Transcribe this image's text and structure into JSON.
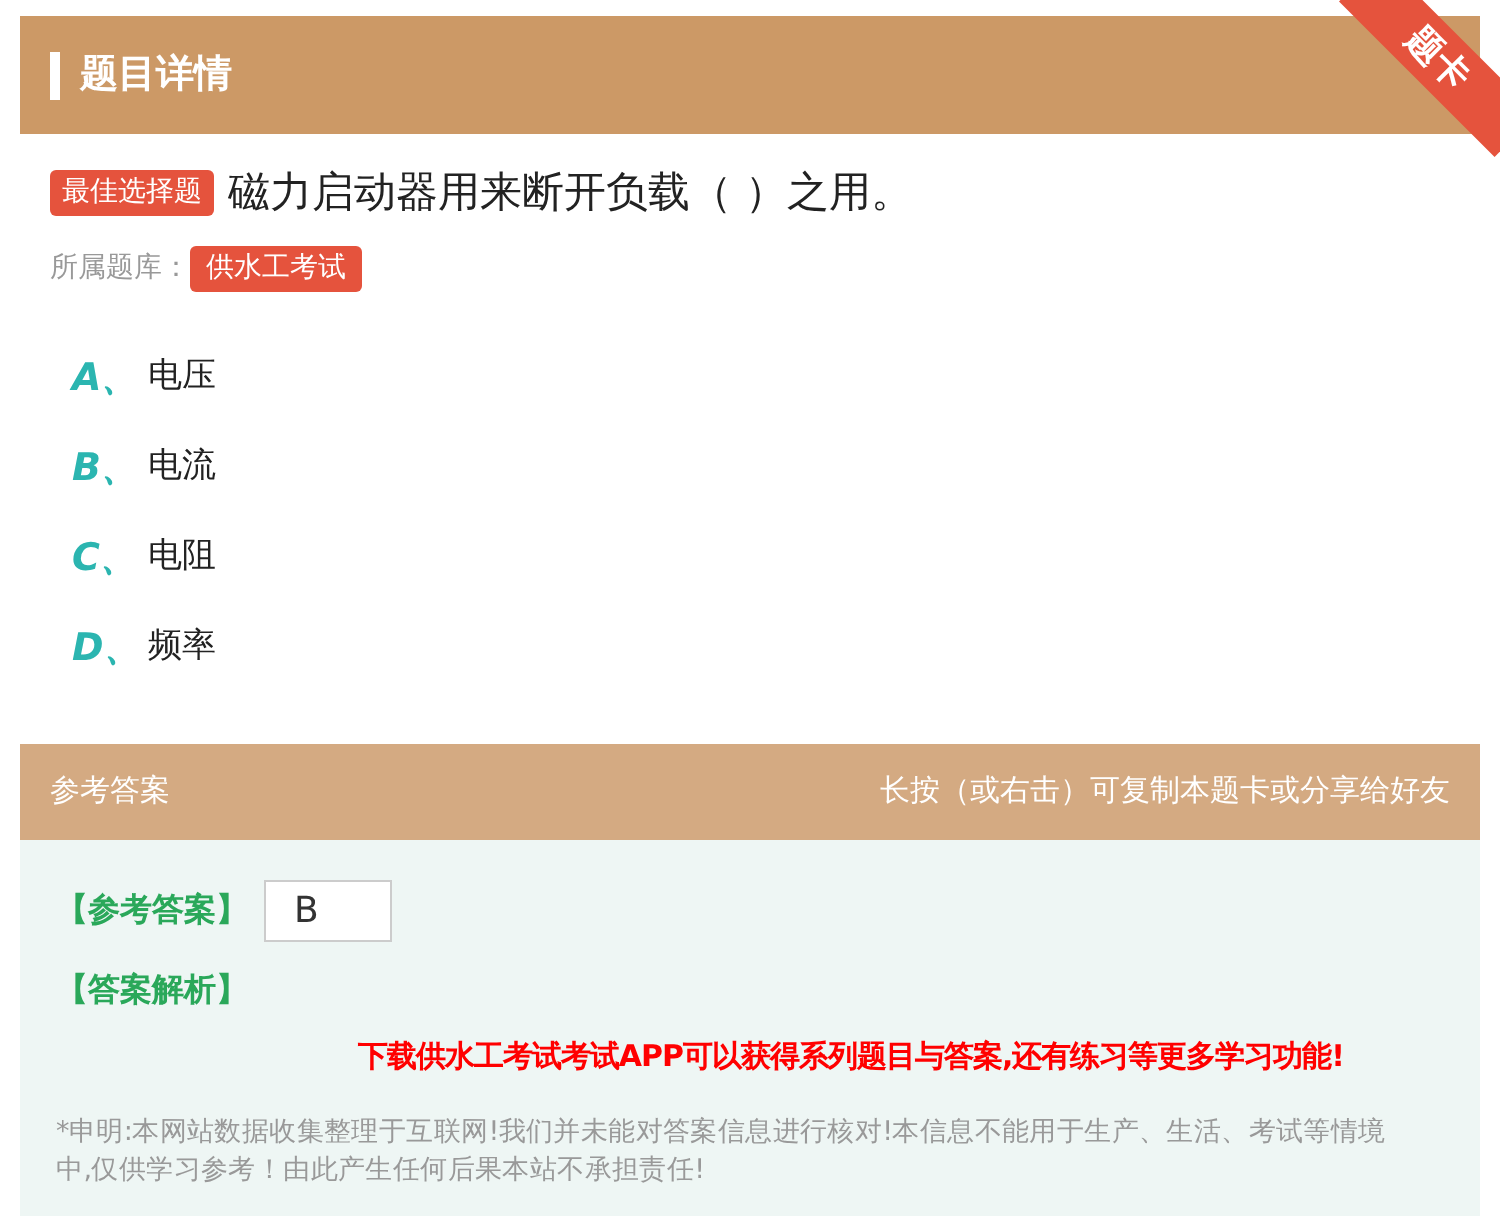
{
  "header": {
    "title": "题目详情",
    "ribbon": "题卡"
  },
  "question": {
    "type_badge": "最佳选择题",
    "text": "磁力启动器用来断开负载（ ）之用。",
    "bank_label": "所属题库：",
    "bank": "供水工考试"
  },
  "options": [
    {
      "letter": "A、",
      "text": "电压"
    },
    {
      "letter": "B、",
      "text": "电流"
    },
    {
      "letter": "C、",
      "text": "电阻"
    },
    {
      "letter": "D、",
      "text": "频率"
    }
  ],
  "answer_section": {
    "title": "参考答案",
    "hint": "长按（或右击）可复制本题卡或分享给好友",
    "answer_label": "【参考答案】",
    "answer": "B",
    "analysis_label": "【答案解析】",
    "promo": "下载供水工考试考试APP可以获得系列题目与答案,还有练习等更多学习功能!",
    "disclaimer": "*申明:本网站数据收集整理于互联网!我们并未能对答案信息进行核对!本信息不能用于生产、生活、考试等情境中,仅供学习参考！由此产生任何后果本站不承担责任!"
  }
}
